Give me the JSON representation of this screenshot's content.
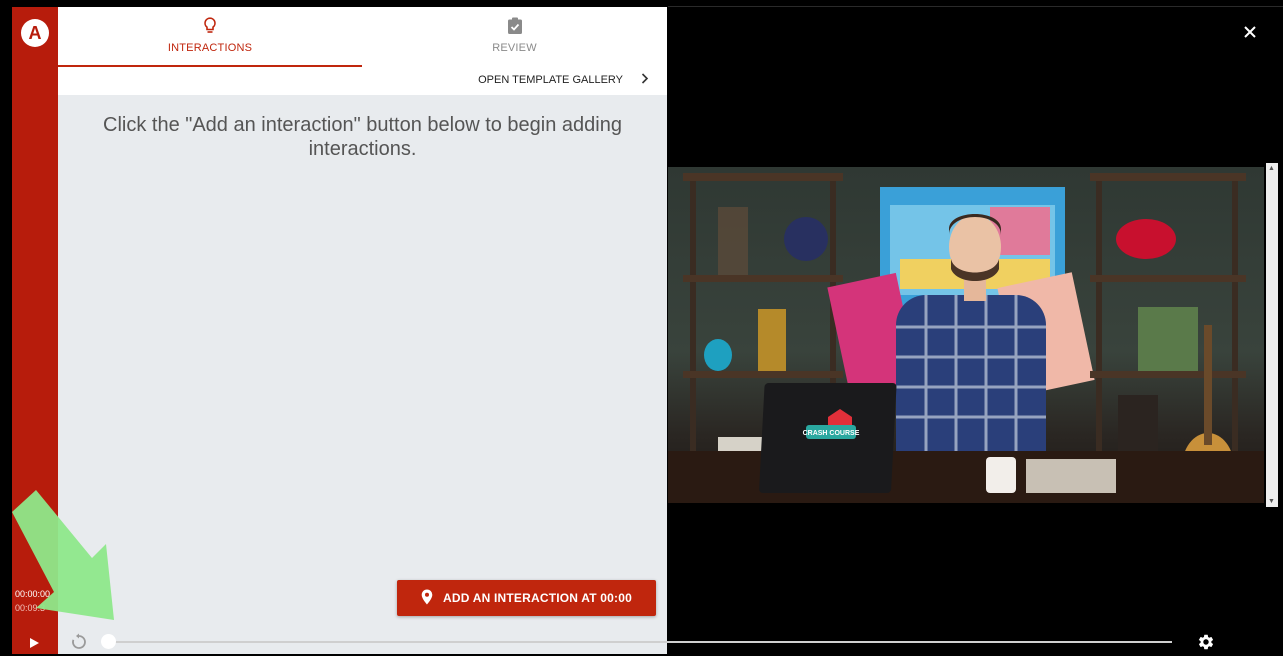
{
  "logo": {
    "text": "A"
  },
  "tabs": [
    {
      "label": "INTERACTIONS",
      "icon": "lightbulb-icon",
      "active": true
    },
    {
      "label": "REVIEW",
      "icon": "clipboard-check-icon",
      "active": false
    }
  ],
  "gallery_link": {
    "label": "OPEN TEMPLATE GALLERY",
    "icon": "chevron-right-icon"
  },
  "empty_message": {
    "line1": "Click the \"Add an interaction\" button below to begin adding",
    "line2": "interactions."
  },
  "add_button": {
    "label": "ADD AN INTERACTION AT 00:00",
    "icon": "map-pin-icon"
  },
  "timeline": {
    "current_time": "00:00:00",
    "total_time": "00:09:3",
    "progress": 0
  },
  "video": {
    "overlay_logo": "CRASH COURSE"
  },
  "colors": {
    "brand": "#b71c0c",
    "accent": "#c0260d",
    "arrow": "#8ee88a"
  }
}
